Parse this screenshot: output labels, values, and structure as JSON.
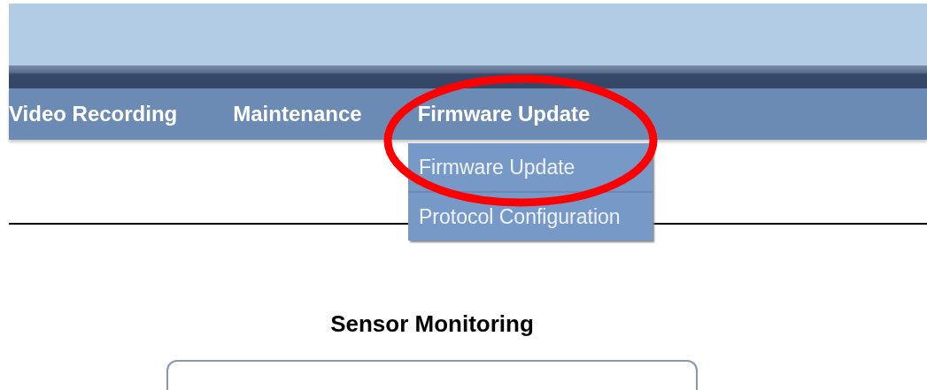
{
  "nav": {
    "items": [
      {
        "label": "Video Recording"
      },
      {
        "label": "Maintenance"
      },
      {
        "label": "Firmware Update"
      }
    ]
  },
  "dropdown": {
    "items": [
      {
        "label": "Firmware Update"
      },
      {
        "label": "Protocol Configuration"
      }
    ]
  },
  "annotation": {
    "kind": "ellipse",
    "color": "#ff0000"
  },
  "section": {
    "title": "Sensor Monitoring"
  }
}
